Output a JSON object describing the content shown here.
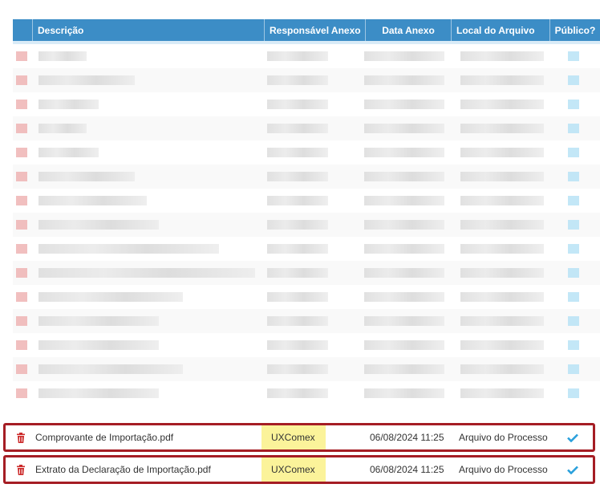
{
  "table": {
    "columns": [
      "",
      "Descrição",
      "Responsável Anexo",
      "Data Anexo",
      "Local do Arquivo",
      "Público?"
    ],
    "highlighted_rows": [
      {
        "descricao": "Comprovante de Importação.pdf",
        "responsavel": "UXComex",
        "data": "06/08/2024 11:25",
        "local": "Arquivo do Processo",
        "publico_icon": "check-icon",
        "action_icon": "trash-icon"
      },
      {
        "descricao": "Extrato da Declaração de Importação.pdf",
        "responsavel": "UXComex",
        "data": "06/08/2024 11:25",
        "local": "Arquivo do Processo",
        "publico_icon": "check-icon",
        "action_icon": "trash-icon"
      }
    ]
  },
  "colors": {
    "header_bg": "#3c8dc6",
    "highlight_border": "#a51d24",
    "responsavel_highlight": "#fbf39a",
    "trash": "#cc2a2a",
    "check": "#2aa0dc"
  }
}
